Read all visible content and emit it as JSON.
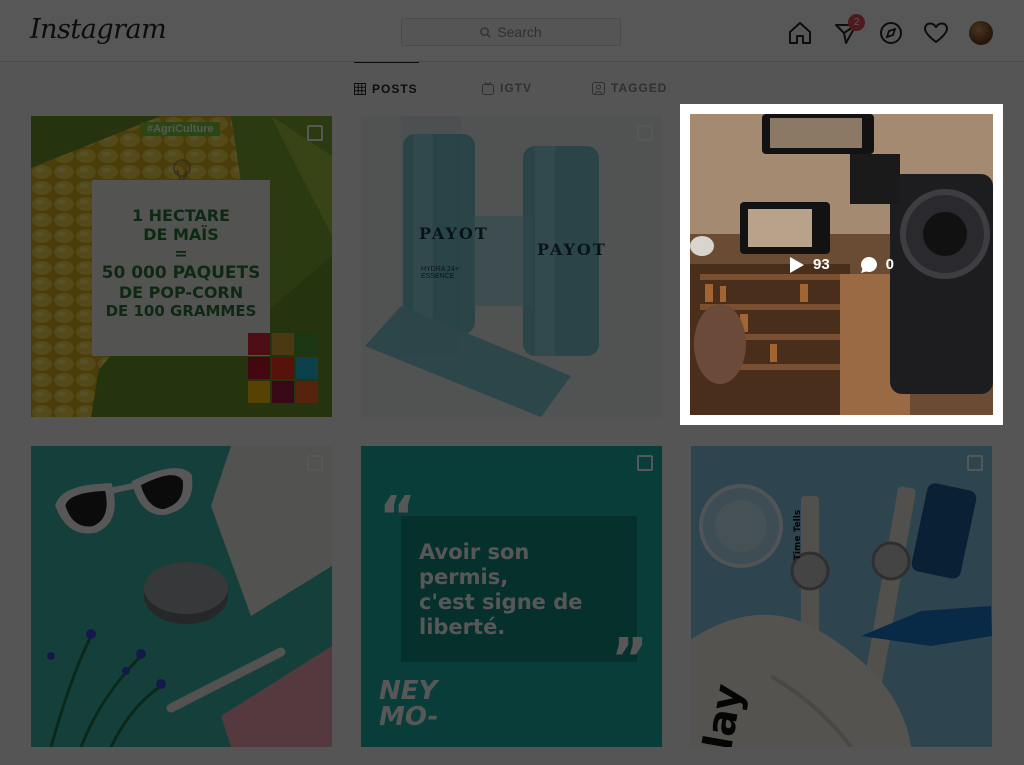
{
  "header": {
    "logo": "Instagram",
    "search_placeholder": "Search",
    "notification_count": "2"
  },
  "tabs": [
    {
      "label": "POSTS",
      "active": true
    },
    {
      "label": "IGTV",
      "active": false
    },
    {
      "label": "TAGGED",
      "active": false
    }
  ],
  "posts": [
    {
      "hashtag": "#AgriCulture",
      "lines": [
        "1 HECTARE",
        "DE MAÏS",
        "=",
        "50 000 PAQUETS",
        "DE POP-CORN",
        "DE 100 GRAMMES"
      ]
    },
    {
      "brand": "PAYOT",
      "product": "HYDRA 24+ ESSENCE"
    },
    {
      "plays": "93",
      "comments": "0"
    },
    {},
    {
      "quote": [
        "Avoir son",
        "permis,",
        "c'est signe de",
        "liberté."
      ],
      "signature": [
        "NEY",
        "MO-"
      ]
    },
    {
      "watch_brand": "Time Tells",
      "bag_text": "lay"
    }
  ],
  "colors": {
    "badge": "#ed4956",
    "overlay": "rgba(0,0,0,0.66)",
    "teal": "#1bb3a6"
  }
}
